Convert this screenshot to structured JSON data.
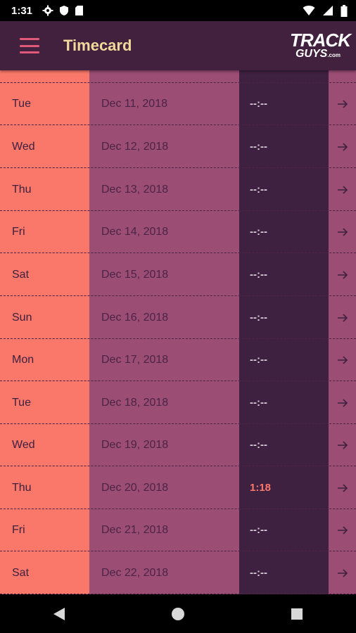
{
  "status_bar": {
    "time": "1:31"
  },
  "app_bar": {
    "title": "Timecard",
    "logo_top": "TRACK",
    "logo_bottom": "GUYS",
    "logo_suffix": ".com"
  },
  "colors": {
    "day_column": "#f9786a",
    "date_column": "#9b4d74",
    "hours_column": "#3e2040",
    "app_bar": "#41213e",
    "title": "#f3d89c"
  },
  "rows": [
    {
      "day": "Tue",
      "date": "Dec 11, 2018",
      "hours": "--:--"
    },
    {
      "day": "Wed",
      "date": "Dec 12, 2018",
      "hours": "--:--"
    },
    {
      "day": "Thu",
      "date": "Dec 13, 2018",
      "hours": "--:--"
    },
    {
      "day": "Fri",
      "date": "Dec 14, 2018",
      "hours": "--:--"
    },
    {
      "day": "Sat",
      "date": "Dec 15, 2018",
      "hours": "--:--"
    },
    {
      "day": "Sun",
      "date": "Dec 16, 2018",
      "hours": "--:--"
    },
    {
      "day": "Mon",
      "date": "Dec 17, 2018",
      "hours": "--:--"
    },
    {
      "day": "Tue",
      "date": "Dec 18, 2018",
      "hours": "--:--"
    },
    {
      "day": "Wed",
      "date": "Dec 19, 2018",
      "hours": "--:--"
    },
    {
      "day": "Thu",
      "date": "Dec 20, 2018",
      "hours": "1:18"
    },
    {
      "day": "Fri",
      "date": "Dec 21, 2018",
      "hours": "--:--"
    },
    {
      "day": "Sat",
      "date": "Dec 22, 2018",
      "hours": "--:--"
    }
  ],
  "icons": {
    "menu": "menu-icon",
    "row_action": "arrow-right-icon",
    "nav_back": "back-icon",
    "nav_home": "home-icon",
    "nav_recents": "recents-icon"
  }
}
